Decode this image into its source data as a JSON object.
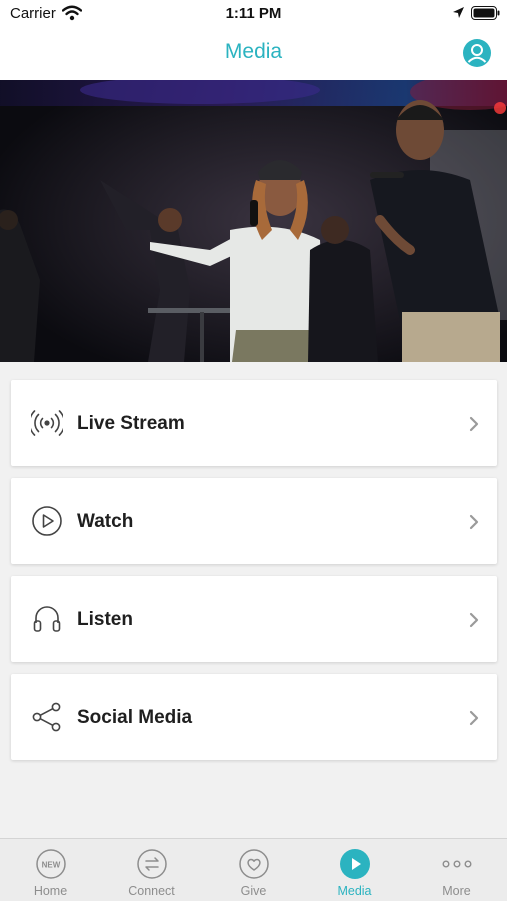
{
  "status_bar": {
    "carrier": "Carrier",
    "time": "1:11 PM"
  },
  "header": {
    "title": "Media"
  },
  "menu": [
    {
      "label": "Live Stream",
      "icon": "broadcast-icon"
    },
    {
      "label": "Watch",
      "icon": "play-circle-icon"
    },
    {
      "label": "Listen",
      "icon": "headphones-icon"
    },
    {
      "label": "Social Media",
      "icon": "share-icon"
    }
  ],
  "tabs": [
    {
      "label": "Home",
      "icon": "new-badge-icon",
      "badge": "NEW"
    },
    {
      "label": "Connect",
      "icon": "arrows-exchange-icon"
    },
    {
      "label": "Give",
      "icon": "heart-icon"
    },
    {
      "label": "Media",
      "icon": "play-circle-icon",
      "active": true
    },
    {
      "label": "More",
      "icon": "more-dots-icon"
    }
  ],
  "colors": {
    "accent": "#2bb3c0",
    "background": "#f1f1f1",
    "text": "#1f1f1f",
    "inactive": "#8d8d8d"
  }
}
